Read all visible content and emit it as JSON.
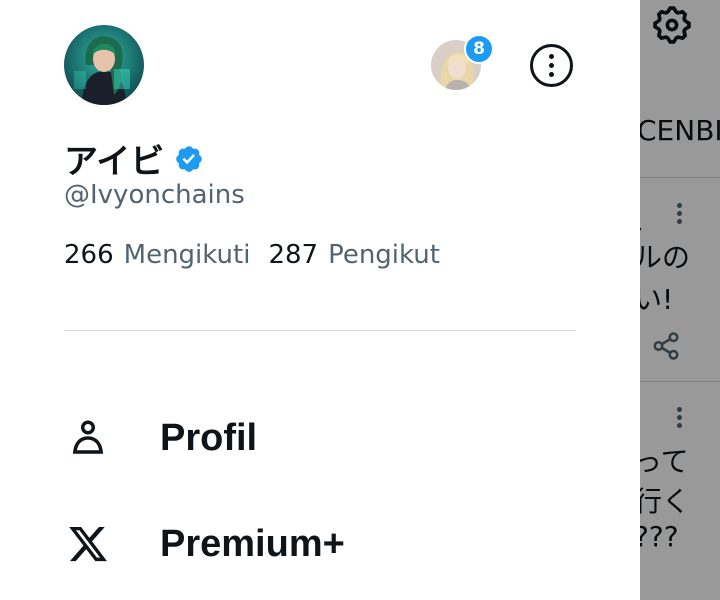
{
  "profile": {
    "display_name": "アイビ",
    "handle": "@Ivyonchains",
    "following_count": "266",
    "following_label": "Mengikuti",
    "followers_count": "287",
    "followers_label": "Pengikut"
  },
  "accounts": {
    "notification_badge": "8"
  },
  "menu": [
    {
      "label": "Profil",
      "icon": "person-icon"
    },
    {
      "label": "Premium+",
      "icon": "x-logo-icon"
    }
  ],
  "background": {
    "tab_text": "CENBI",
    "post1_lines": [
      "、",
      "ルの",
      "い!"
    ],
    "post2_lines": [
      "って",
      "行く",
      "???"
    ]
  },
  "colors": {
    "accent": "#1d9bf0",
    "text": "#0f1419",
    "muted": "#536471",
    "divider": "#cfd9de"
  }
}
